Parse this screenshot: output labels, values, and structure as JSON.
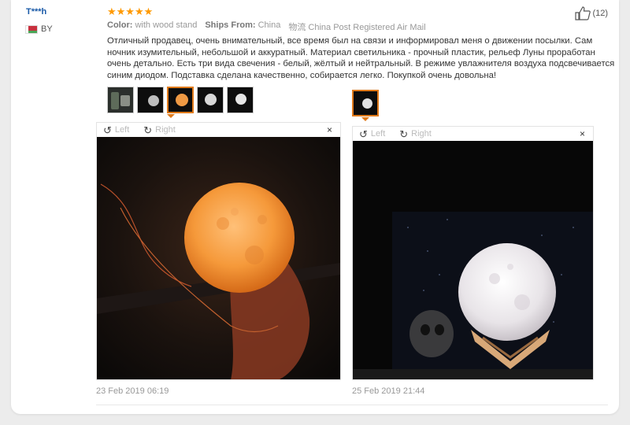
{
  "user": {
    "name": "T***h",
    "country": "BY"
  },
  "rating": {
    "stars": "★★★★★",
    "value": 5
  },
  "meta": {
    "color_label": "Color:",
    "color_value": "with wood stand",
    "ships_label": "Ships From:",
    "ships_value": "China",
    "shipping_label": "物流",
    "shipping_value": "China Post Registered Air Mail"
  },
  "likes": {
    "count": "(12)"
  },
  "review_text": "Отличный продавец, очень внимательный, все время был на связи и информировал меня о движении посылки. Сам ночник изумительный, небольшой и аккуратный. Материал светильника - прочный пластик, рельеф Луны проработан очень детально. Есть три вида свечения - белый, жёлтый и нейтральный. В режиме увлажнителя воздуха подсвечивается синим диодом. Подставка сделана качественно, собирается легко. Покупкой очень довольна!",
  "viewers": [
    {
      "left_label": "Left",
      "right_label": "Right",
      "close": "×",
      "date": "23 Feb 2019 06:19"
    },
    {
      "left_label": "Left",
      "right_label": "Right",
      "close": "×",
      "date": "25 Feb 2019 21:44"
    }
  ],
  "colors": {
    "accent": "#e07a1a",
    "star": "#ff9900",
    "username": "#1a5aa8"
  }
}
